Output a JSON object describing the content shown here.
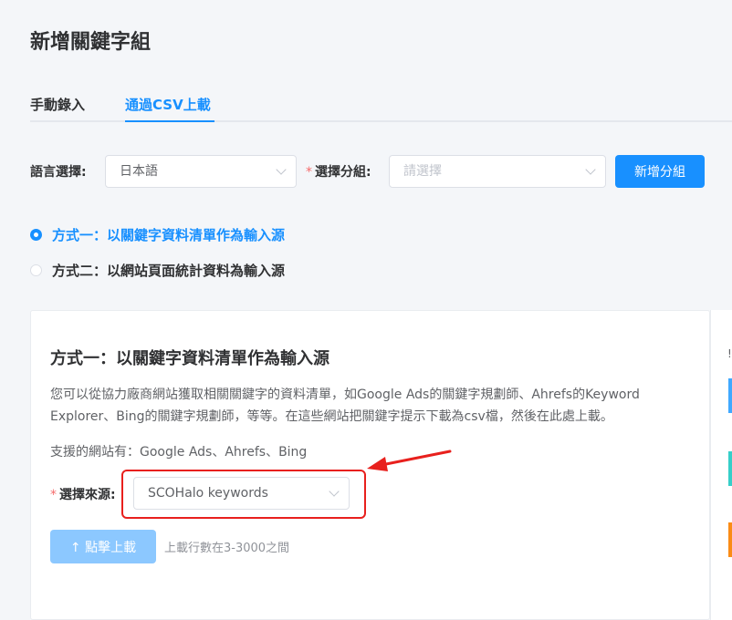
{
  "page": {
    "title": "新增關鍵字組"
  },
  "tabs": [
    {
      "label": "手動錄入",
      "active": false
    },
    {
      "label": "通過CSV上載",
      "active": true
    }
  ],
  "filters": {
    "language_label": "語言選擇:",
    "language_value": "日本語",
    "group_label": "選擇分組:",
    "group_placeholder": "請選擇",
    "add_group_button": "新增分組"
  },
  "methods": [
    {
      "label": "方式一：以關鍵字資料清單作為輸入源",
      "selected": true
    },
    {
      "label": "方式二：以網站頁面統計資料為輸入源",
      "selected": false
    }
  ],
  "card": {
    "title": "方式一：以關鍵字資料清單作為輸入源",
    "description": "您可以從協力廠商網站獲取相關關鍵字的資料清單，如Google Ads的關鍵字規劃師、Ahrefs的Keyword Explorer、Bing的關鍵字規劃師，等等。在這些網站把關鍵字提示下載為csv檔，然後在此處上載。",
    "support_text": "支援的網站有：Google Ads、Ahrefs、Bing",
    "source_label": "選擇來源:",
    "source_value": "SCOHalo keywords",
    "upload_icon": "↑",
    "upload_button": "點擊上載",
    "upload_hint": "上載行數在3-3000之間"
  },
  "side_panel": {
    "char": "!"
  },
  "colors": {
    "primary": "#1890ff",
    "required": "#f56c6c",
    "highlight": "#e8201d",
    "side_blue": "#40a9ff",
    "side_teal": "#36cfc9",
    "side_orange": "#fa8c16"
  }
}
